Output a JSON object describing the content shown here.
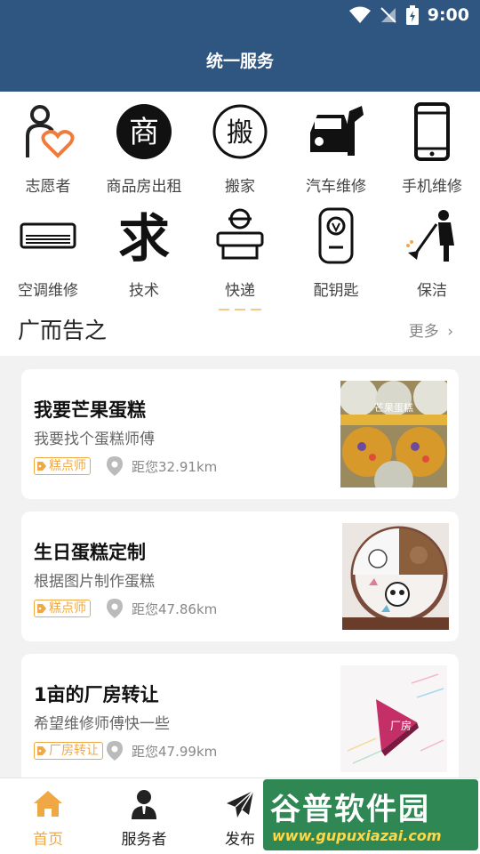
{
  "status_bar": {
    "time": "9:00"
  },
  "header": {
    "title": "统一服务"
  },
  "categories": [
    {
      "label": "志愿者",
      "icon": "volunteer-heart-icon"
    },
    {
      "label": "商品房出租",
      "icon": "shang-char-icon",
      "glyph": "商"
    },
    {
      "label": "搬家",
      "icon": "ban-char-icon",
      "glyph": "搬"
    },
    {
      "label": "汽车维修",
      "icon": "car-wrench-icon"
    },
    {
      "label": "手机维修",
      "icon": "phone-icon"
    },
    {
      "label": "空调维修",
      "icon": "air-conditioner-icon"
    },
    {
      "label": "技术",
      "icon": "qiu-char-icon",
      "glyph": "求"
    },
    {
      "label": "快递",
      "icon": "courier-icon"
    },
    {
      "label": "配钥匙",
      "icon": "car-key-icon"
    },
    {
      "label": "保洁",
      "icon": "cleaner-icon"
    }
  ],
  "ads": {
    "title": "广而告之",
    "more": "更多"
  },
  "posts": [
    {
      "title": "我要芒果蛋糕",
      "desc": "我要找个蛋糕师傅",
      "tag": "糕点师",
      "distance": "距您32.91km",
      "image_text": "芒果蛋糕"
    },
    {
      "title": "生日蛋糕定制",
      "desc": "根据图片制作蛋糕",
      "tag": "糕点师",
      "distance": "距您47.86km"
    },
    {
      "title": "1亩的厂房转让",
      "desc": "希望维修师傅快一些",
      "tag": "厂房转让",
      "distance": "距您47.99km",
      "image_text": "厂房"
    }
  ],
  "tabs": [
    {
      "label": "首页",
      "icon": "home-icon",
      "active": true
    },
    {
      "label": "服务者",
      "icon": "person-icon"
    },
    {
      "label": "发布",
      "icon": "paper-plane-icon"
    }
  ],
  "watermark": {
    "title": "谷普软件园",
    "url": "www.gupuxiazai.com"
  },
  "colors": {
    "header": "#2f5581",
    "accent": "#f0a844",
    "heart": "#f07b3a"
  }
}
